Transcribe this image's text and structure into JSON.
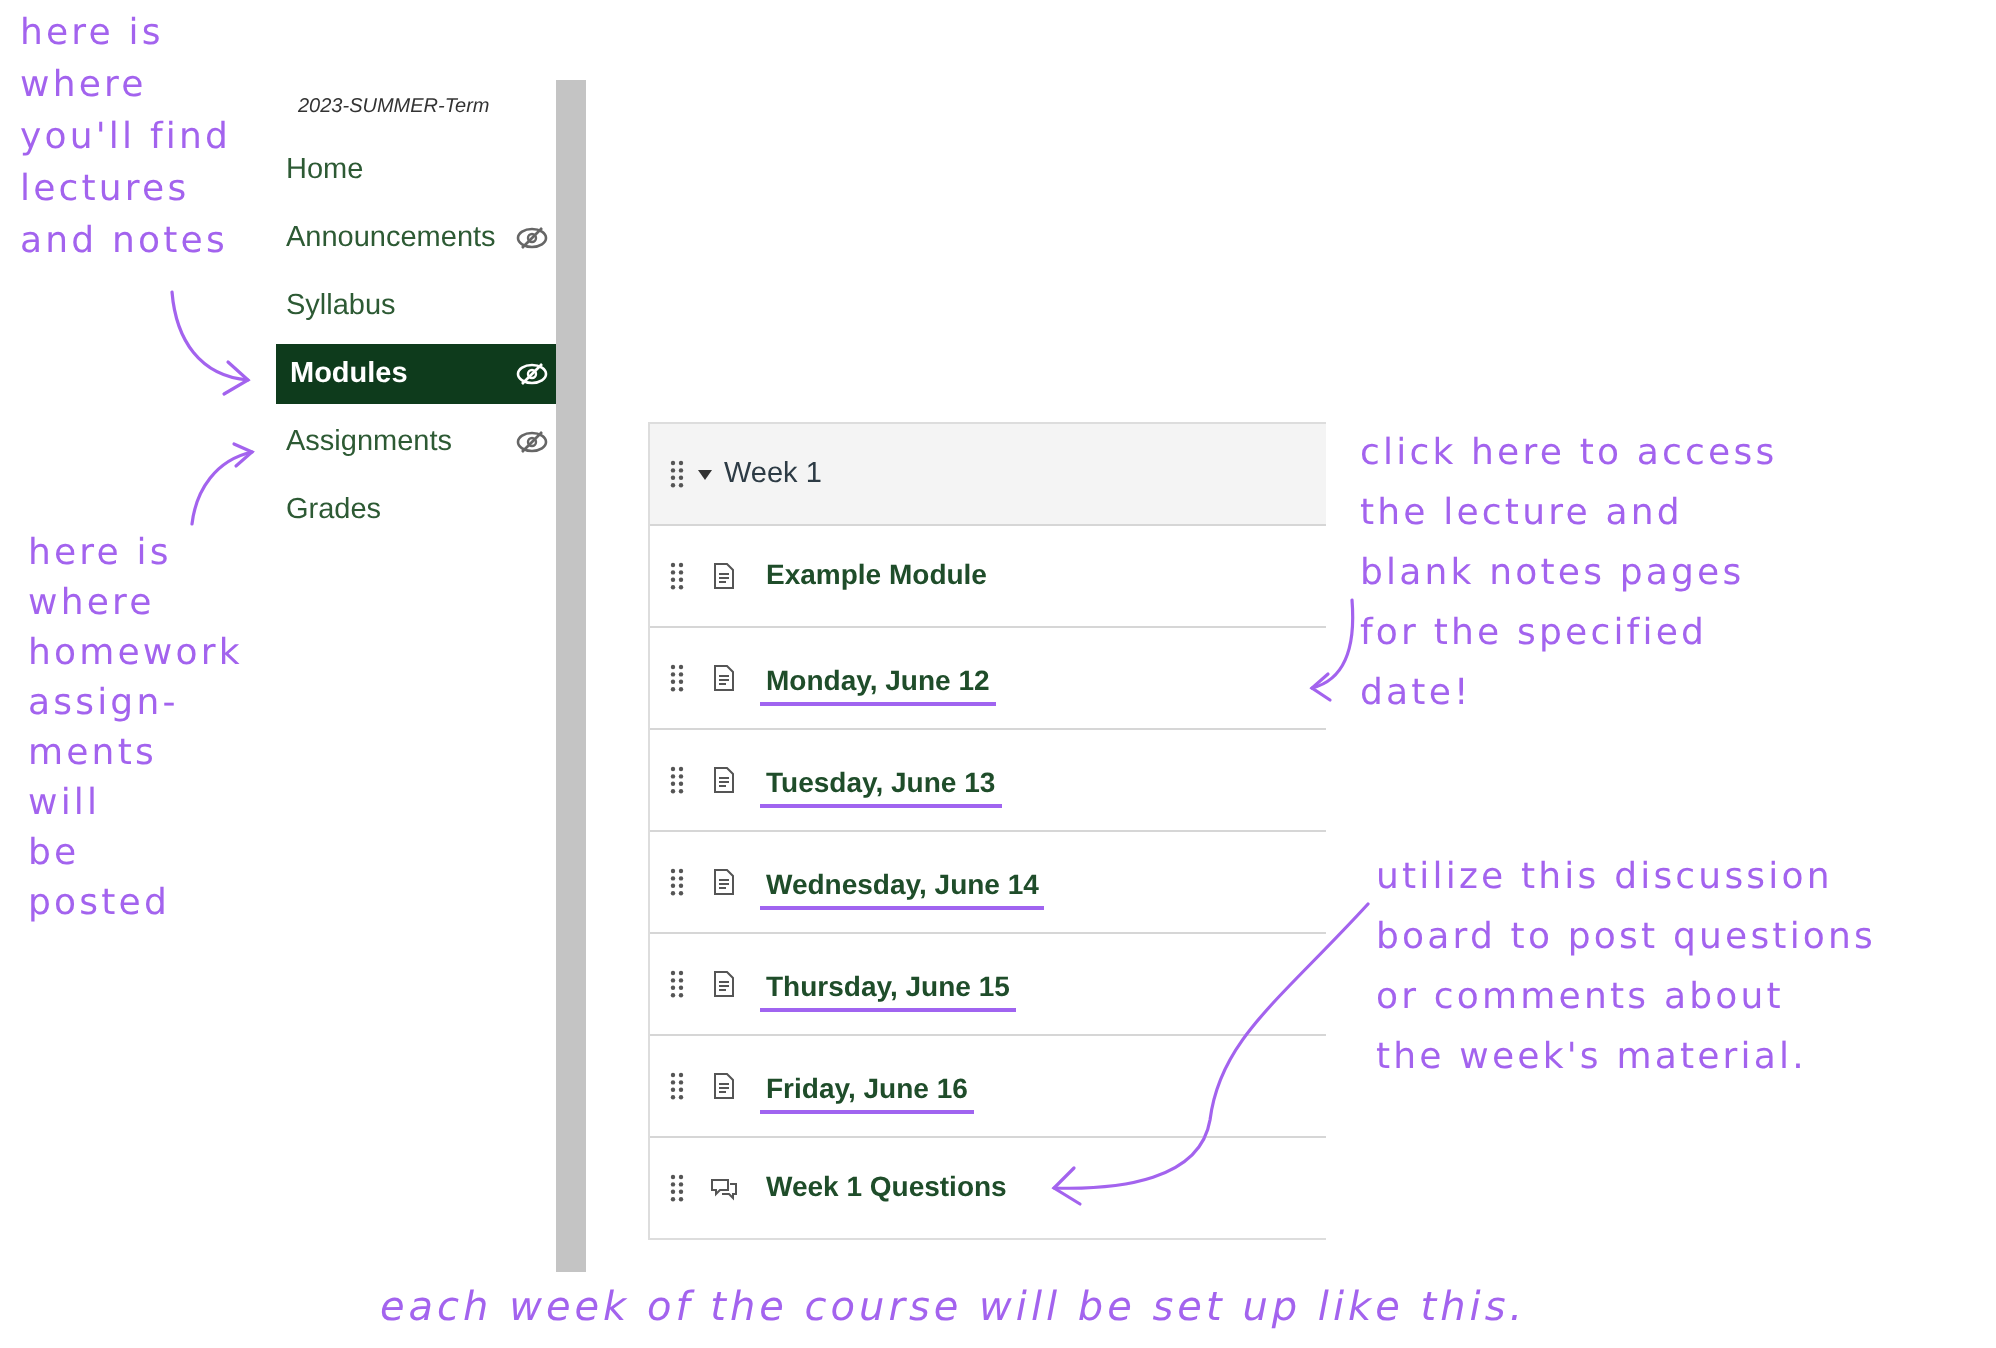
{
  "course": {
    "term": "2023-SUMMER-Term"
  },
  "sidebar": {
    "items": [
      {
        "label": "Home",
        "selected": false,
        "hidden_from_students": false
      },
      {
        "label": "Announcements",
        "selected": false,
        "hidden_from_students": true
      },
      {
        "label": "Syllabus",
        "selected": false,
        "hidden_from_students": false
      },
      {
        "label": "Modules",
        "selected": true,
        "hidden_from_students": true
      },
      {
        "label": "Assignments",
        "selected": false,
        "hidden_from_students": true
      },
      {
        "label": "Grades",
        "selected": false,
        "hidden_from_students": false
      }
    ]
  },
  "module": {
    "title": "Week 1",
    "expanded": true,
    "items": [
      {
        "kind": "page",
        "title": "Example Module",
        "underlined": false
      },
      {
        "kind": "page",
        "title": "Monday, June 12",
        "underlined": true
      },
      {
        "kind": "page",
        "title": "Tuesday, June 13",
        "underlined": true
      },
      {
        "kind": "page",
        "title": "Wednesday, June 14",
        "underlined": true
      },
      {
        "kind": "page",
        "title": "Thursday, June 15",
        "underlined": true
      },
      {
        "kind": "page",
        "title": "Friday, June 16",
        "underlined": true
      },
      {
        "kind": "discussion",
        "title": "Week 1 Questions",
        "underlined": false
      }
    ]
  },
  "annotations": [
    {
      "text": "here is\nwhere\nyou'll find\nlectures\nand notes"
    },
    {
      "text": "here is\nwhere\nhomework\nassign-\nments\nwill\nbe\nposted"
    },
    {
      "text": "click here to access\nthe lecture and\nblank notes pages\nfor the specified\ndate!"
    },
    {
      "text": "utilize this discussion\nboard to post questions\nor comments about\nthe week's material."
    },
    {
      "text": "each week of the course will be set up like this."
    }
  ]
}
